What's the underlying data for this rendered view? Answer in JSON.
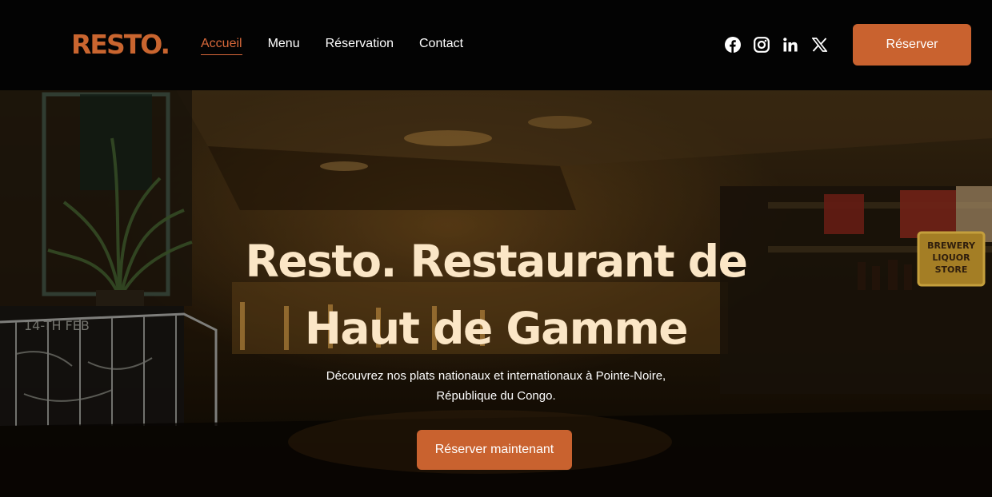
{
  "header": {
    "logo": "RESTO.",
    "nav": [
      {
        "label": "Accueil",
        "active": true
      },
      {
        "label": "Menu",
        "active": false
      },
      {
        "label": "Réservation",
        "active": false
      },
      {
        "label": "Contact",
        "active": false
      }
    ],
    "socials": [
      "facebook-icon",
      "instagram-icon",
      "linkedin-icon",
      "x-icon"
    ],
    "cta_label": "Réserver"
  },
  "hero": {
    "title_line1": "Resto. Restaurant de",
    "title_line2": "Haut de Gamme",
    "subtitle_line1": "Découvrez nos plats nationaux et internationaux à Pointe-Noire,",
    "subtitle_line2": "République du Congo.",
    "cta_label": "Réserver maintenant",
    "background_image": "restaurant-interior-photo",
    "sign_text_1": "BREWERY",
    "sign_text_2": "LIQUOR",
    "sign_text_3": "STORE",
    "chalkboard_text": "14-TH    FEB"
  },
  "colors": {
    "accent": "#c9622f",
    "nav_active": "#d8683a",
    "title": "#fbe6c6",
    "header_bg": "#030303"
  }
}
